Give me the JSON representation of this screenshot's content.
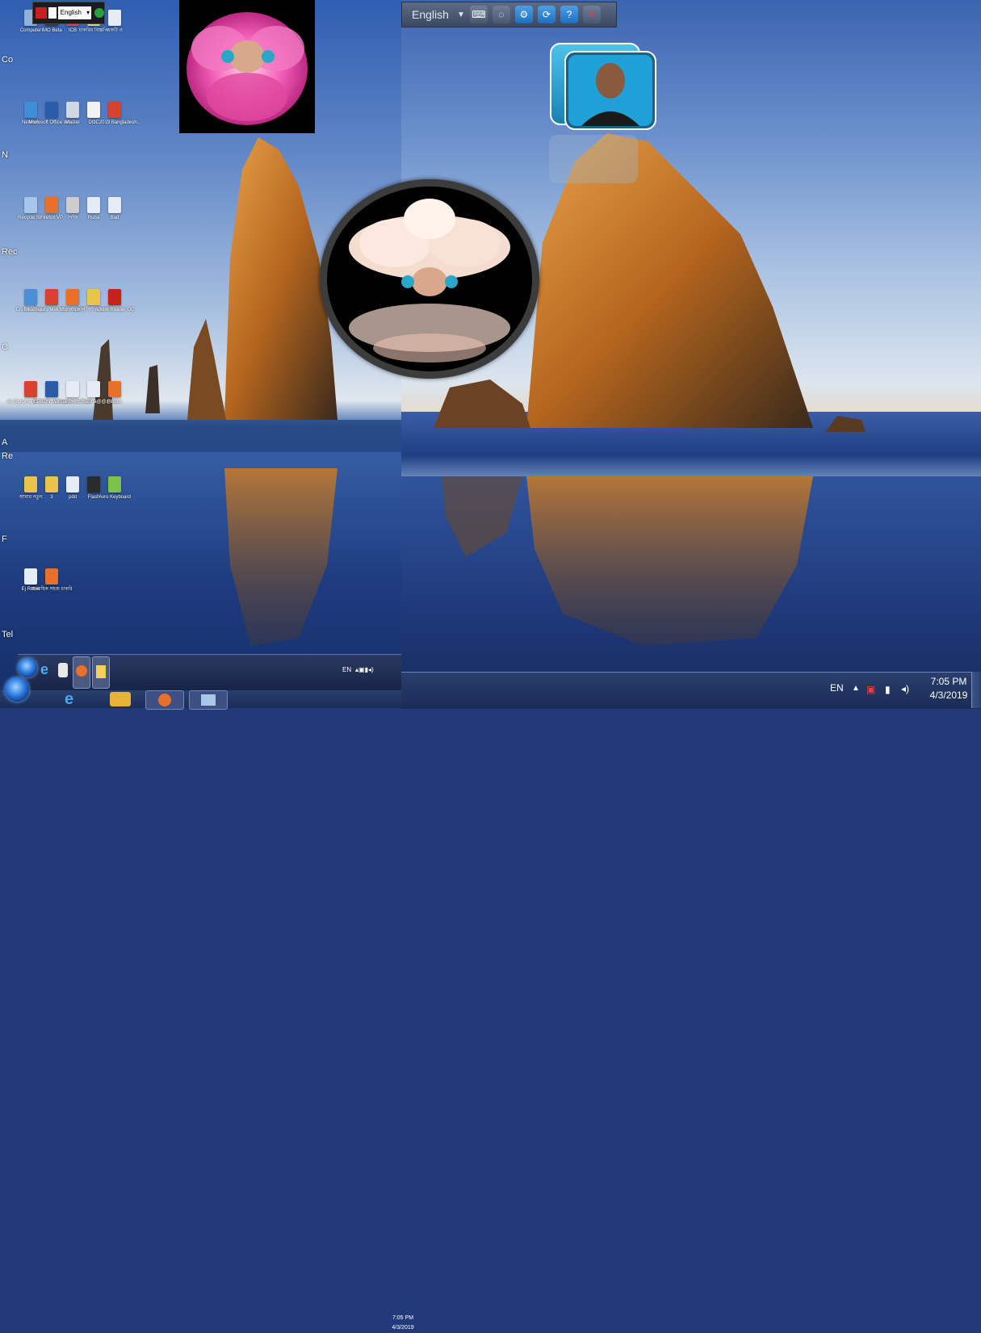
{
  "language_bar": {
    "small_lang": "English",
    "big_lang": "English",
    "icons": [
      "keyboard-icon",
      "mouse-icon",
      "settings-icon",
      "sync-icon",
      "help-icon",
      "close-icon"
    ]
  },
  "desktop_icons": [
    {
      "label": "Computer",
      "color": "#8fb1d8"
    },
    {
      "label": "IMO Beta",
      "color": "#3a3a3a"
    },
    {
      "label": "ICB",
      "color": "#d34a3a"
    },
    {
      "label": "চাকরির বিজ্ঞপ্তি",
      "color": "#e7d36a"
    },
    {
      "label": "একটি ও",
      "color": "#e6ecf6"
    },
    {
      "label": "Network",
      "color": "#3e8ed6"
    },
    {
      "label": "Microsoft Office Wo...",
      "color": "#2a5caa"
    },
    {
      "label": "Master",
      "color": "#d0d7e4"
    },
    {
      "label": "1",
      "color": "#f2f2f2"
    },
    {
      "label": "DOC2019 Bangladesh...",
      "color": "#d84030"
    },
    {
      "label": "Recycle Bin",
      "color": "#a6c8e8"
    },
    {
      "label": "Firefox VP",
      "color": "#e8702a"
    },
    {
      "label": "পিজি",
      "color": "#cccccc"
    },
    {
      "label": "Ruba",
      "color": "#e6ecf6"
    },
    {
      "label": "Bad",
      "color": "#e6ecf6"
    },
    {
      "label": "Control Panel",
      "color": "#4d8fd6"
    },
    {
      "label": "Bikashguru MakSBooks...",
      "color": "#d84030"
    },
    {
      "label": "মাত্র পরিবর্তন",
      "color": "#e8702a"
    },
    {
      "label": "কোর্স নিউজ মাস্টার",
      "color": "#e8c44a"
    },
    {
      "label": "Adobe Reader DC",
      "color": "#c8201a"
    },
    {
      "label": "Ab Diploma Exam ff ...",
      "color": "#d84030"
    },
    {
      "label": "EPSON Manuals",
      "color": "#2a5caa"
    },
    {
      "label": "Virtual Marksheet",
      "color": "#e6ecf6"
    },
    {
      "label": "উপাত্ত Rubina@@@.d...",
      "color": "#e6ecf6"
    },
    {
      "label": "Firefox",
      "color": "#e8702a"
    },
    {
      "label": "আমার নতুন",
      "color": "#e8c44a"
    },
    {
      "label": "3",
      "color": "#e8c44a"
    },
    {
      "label": "pdd",
      "color": "#e6ecf6"
    },
    {
      "label": "Flash",
      "color": "#2b2b2b"
    },
    {
      "label": "Avro Keyboard",
      "color": "#7cc24a"
    },
    {
      "label": "Ej Rubin",
      "color": "#e6ecf6"
    },
    {
      "label": "সাপ্তাহিক সহজ চাকরি",
      "color": "#e8702a"
    }
  ],
  "edge_labels": [
    "Co",
    "N",
    "Rec",
    "C",
    "A",
    "Re",
    "F",
    "Tel"
  ],
  "frames": {
    "rose_frame": "pink-rose-photo-frame",
    "circle_frame": "white-rose-reflection-frame",
    "cube_frame": "portrait-cube-frame"
  },
  "taskbar_main": {
    "lang": "EN",
    "time": "7:05 PM",
    "date": "4/3/2019"
  },
  "taskbar_small": {
    "lang": "EN",
    "time": "7:05 PM",
    "date": "4/3/2019"
  },
  "colors": {
    "taskbar": "#1a2b55",
    "sky": "#6d92cd",
    "rock": "#b5651d"
  }
}
